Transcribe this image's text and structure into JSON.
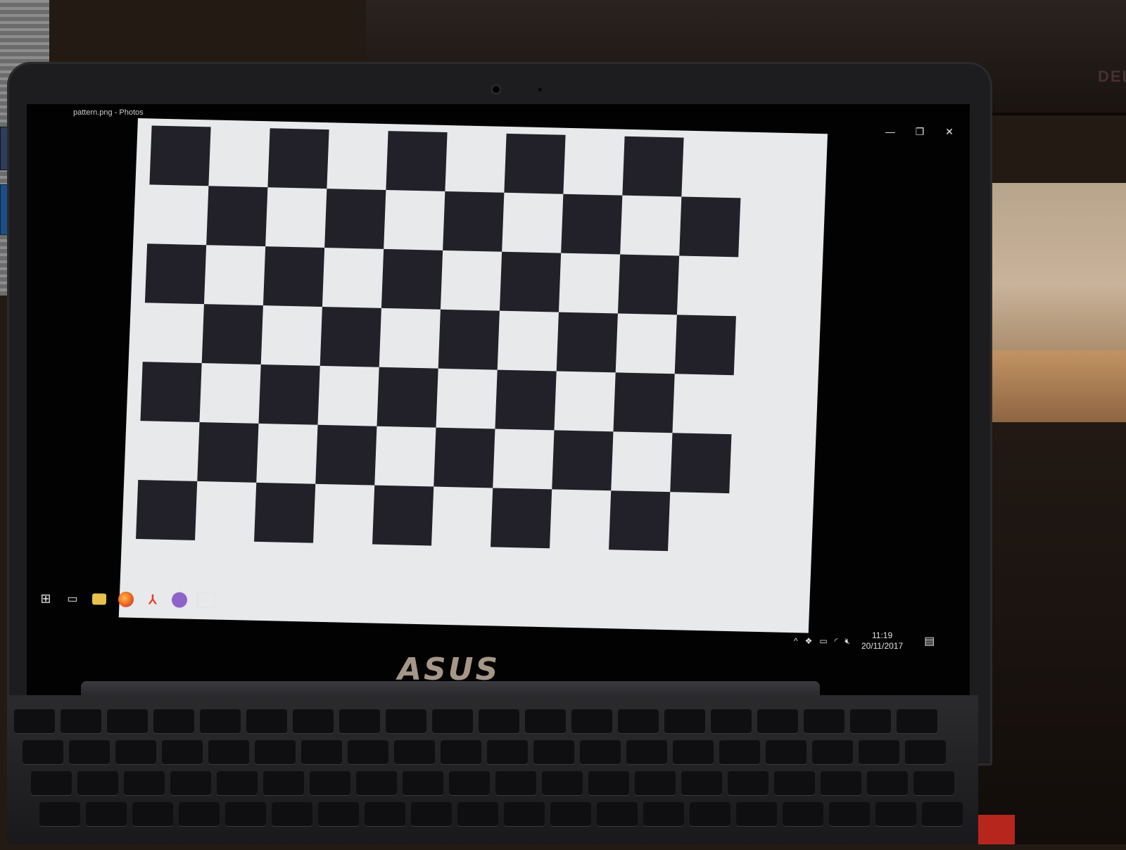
{
  "window": {
    "title": "pattern.png - Photos",
    "controls": {
      "minimize": "—",
      "restore": "❐",
      "close": "✕"
    }
  },
  "image_viewer": {
    "content": "checkerboard",
    "rows": 7,
    "cols": 10,
    "square_color": "#22212a",
    "background_color": "#e7e9ea"
  },
  "taskbar": {
    "apps": [
      {
        "name": "start",
        "icon": "windows-logo-icon"
      },
      {
        "name": "task-view",
        "icon": "task-view-icon"
      },
      {
        "name": "file-explorer",
        "icon": "folder-icon"
      },
      {
        "name": "firefox",
        "icon": "firefox-icon"
      },
      {
        "name": "acrobat",
        "icon": "acrobat-icon"
      },
      {
        "name": "github",
        "icon": "github-icon"
      },
      {
        "name": "photos",
        "icon": "photos-icon"
      }
    ],
    "tray": {
      "time": "11:19",
      "date": "20/11/2017",
      "icons": [
        "chevron-up-icon",
        "dropbox-icon",
        "battery-icon",
        "wifi-icon",
        "volume-muted-icon",
        "notification-icon"
      ]
    }
  },
  "hardware": {
    "laptop_brand": "ASUS",
    "monitor_brand": "DELL"
  },
  "colors": {
    "bezel": "#1d1d1f",
    "screen_bg": "#020203",
    "accent_taskbar": "#9bb7d8"
  }
}
